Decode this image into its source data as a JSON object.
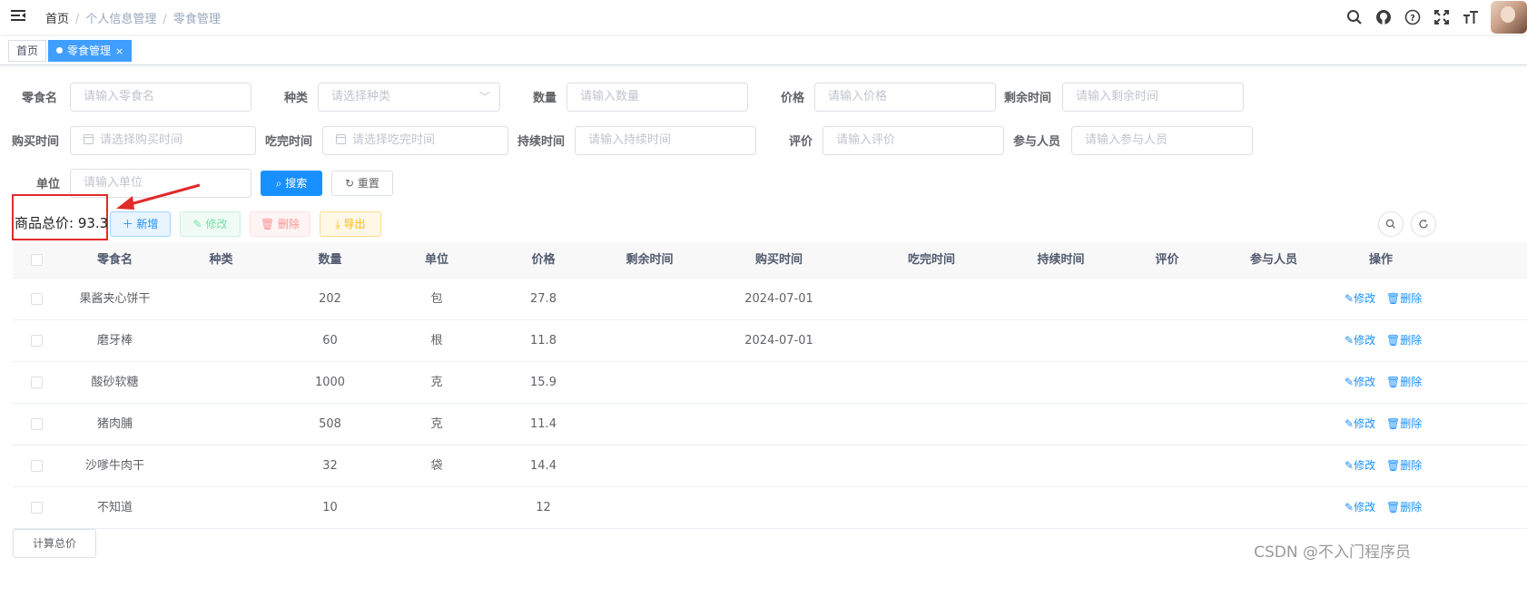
{
  "header": {
    "breadcrumb": {
      "home": "首页",
      "sep1": "/",
      "section": "个人信息管理",
      "sep2": "/",
      "page": "零食管理"
    },
    "icons": [
      "search-icon",
      "github-icon",
      "help-icon",
      "fullscreen-icon",
      "font-size-icon"
    ]
  },
  "tags": [
    {
      "label": "首页",
      "close": ""
    },
    {
      "label": "零食管理",
      "close": "×"
    }
  ],
  "form": {
    "name": {
      "label": "零食名",
      "placeholder": "请输入零食名"
    },
    "type": {
      "label": "种类",
      "placeholder": "请选择种类"
    },
    "quantity": {
      "label": "数量",
      "placeholder": "请输入数量"
    },
    "price": {
      "label": "价格",
      "placeholder": "请输入价格"
    },
    "remaining": {
      "label": "剩余时间",
      "placeholder": "请输入剩余时间"
    },
    "buy_time": {
      "label": "购买时间",
      "placeholder": "请选择购买时间"
    },
    "eat_time": {
      "label": "吃完时间",
      "placeholder": "请选择吃完时间"
    },
    "duration": {
      "label": "持续时间",
      "placeholder": "请输入持续时间"
    },
    "rating": {
      "label": "评价",
      "placeholder": "请输入评价"
    },
    "people": {
      "label": "参与人员",
      "placeholder": "请输入参与人员"
    },
    "unit": {
      "label": "单位",
      "placeholder": "请输入单位"
    },
    "search_label": "搜索",
    "reset_label": "重置"
  },
  "toolbar": {
    "total": "商品总价: 93.3",
    "add_label": "新增",
    "edit_label": "修改",
    "delete_label": "删除",
    "export_label": "导出"
  },
  "table": {
    "columns": [
      "零食名",
      "种类",
      "数量",
      "单位",
      "价格",
      "剩余时间",
      "购买时间",
      "吃完时间",
      "持续时间",
      "评价",
      "参与人员",
      "操作"
    ],
    "rows": [
      {
        "name": "果酱夹心饼干",
        "type": "",
        "quantity": "202",
        "unit": "包",
        "price": "27.8",
        "remaining": "",
        "buy_time": "2024-07-01",
        "eat_time": "",
        "duration": "",
        "rating": "",
        "people": ""
      },
      {
        "name": "磨牙棒",
        "type": "",
        "quantity": "60",
        "unit": "根",
        "price": "11.8",
        "remaining": "",
        "buy_time": "2024-07-01",
        "eat_time": "",
        "duration": "",
        "rating": "",
        "people": ""
      },
      {
        "name": "酸砂软糖",
        "type": "",
        "quantity": "1000",
        "unit": "克",
        "price": "15.9",
        "remaining": "",
        "buy_time": "",
        "eat_time": "",
        "duration": "",
        "rating": "",
        "people": ""
      },
      {
        "name": "猪肉脯",
        "type": "",
        "quantity": "508",
        "unit": "克",
        "price": "11.4",
        "remaining": "",
        "buy_time": "",
        "eat_time": "",
        "duration": "",
        "rating": "",
        "people": ""
      },
      {
        "name": "沙嗲牛肉干",
        "type": "",
        "quantity": "32",
        "unit": "袋",
        "price": "14.4",
        "remaining": "",
        "buy_time": "",
        "eat_time": "",
        "duration": "",
        "rating": "",
        "people": ""
      },
      {
        "name": "不知道",
        "type": "",
        "quantity": "10",
        "unit": "",
        "price": "12",
        "remaining": "",
        "buy_time": "",
        "eat_time": "",
        "duration": "",
        "rating": "",
        "people": ""
      }
    ],
    "row_edit_label": "修改",
    "row_delete_label": "删除"
  },
  "footer": {
    "calc_label": "计算总价",
    "watermark": "CSDN @不入门程序员"
  },
  "colors": {
    "primary": "#1890ff",
    "annotation_red": "#e12b2b"
  }
}
